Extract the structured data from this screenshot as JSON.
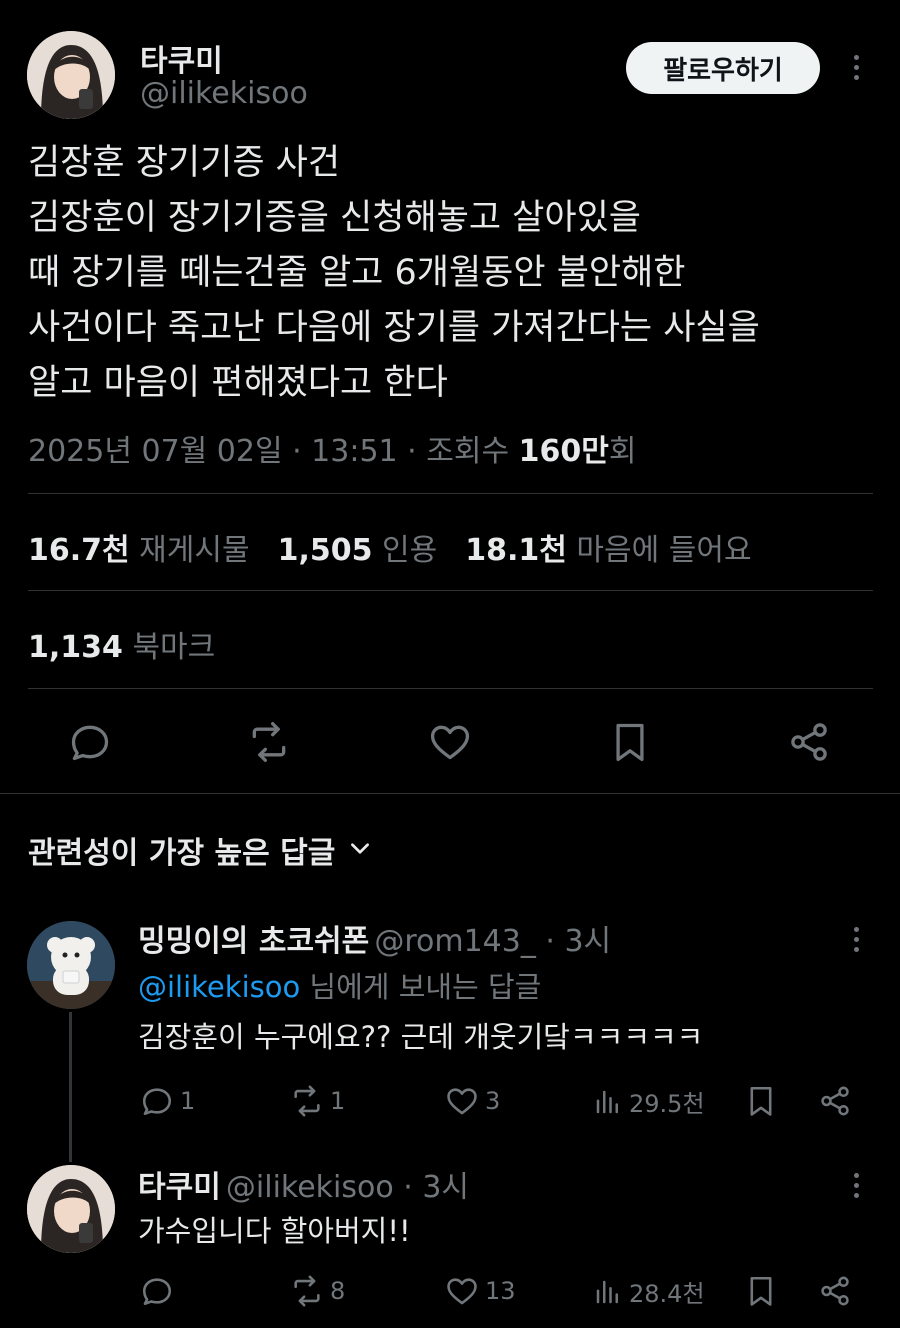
{
  "post": {
    "author_name": "타쿠미",
    "author_handle": "@ilikekisoo",
    "follow_label": "팔로우하기",
    "text_lines": [
      "김장훈 장기기증 사건",
      "김장훈이 장기기증을 신청해놓고 살아있을",
      "때 장기를 떼는건줄 알고 6개월동안 불안해한",
      "사건이다 죽고난 다음에 장기를 가져간다는 사실을",
      "알고 마음이 편해졌다고 한다"
    ],
    "timestamp": "2025년 07월 02일 · 13:51 · 조회수 ",
    "views_value": "160만",
    "views_suffix": "회",
    "stats": {
      "reposts_value": "16.7천",
      "reposts_label": "재게시물",
      "quotes_value": "1,505",
      "quotes_label": "인용",
      "likes_value": "18.1천",
      "likes_label": "마음에 들어요",
      "bookmarks_value": "1,134",
      "bookmarks_label": "북마크"
    }
  },
  "replies_header": "관련성이 가장 높은 답글",
  "replies": [
    {
      "name": "밍밍이의 초코쉬폰",
      "meta": "@rom143_ · 3시",
      "replying_to_handle": "@ilikekisoo",
      "replying_to_suffix": " 님에게 보내는 답글",
      "text": "김장훈이 누구에요?? 근데 개웃기닼ㅋㅋㅋㅋㅋ",
      "reply_count": "1",
      "repost_count": "1",
      "like_count": "3",
      "view_count": "29.5천"
    },
    {
      "name": "타쿠미",
      "meta": "@ilikekisoo · 3시",
      "text": "가수입니다 할아버지!!",
      "reply_count": "",
      "repost_count": "8",
      "like_count": "13",
      "view_count": "28.4천"
    }
  ],
  "colors": {
    "background": "#000000",
    "text": "#e7e9ea",
    "muted": "#71767b",
    "link": "#1d9bf0",
    "divider": "#2f3336"
  },
  "icons": [
    "reply-icon",
    "repost-icon",
    "like-icon",
    "bookmark-icon",
    "share-icon",
    "views-icon",
    "more-icon",
    "chevron-down-icon"
  ]
}
